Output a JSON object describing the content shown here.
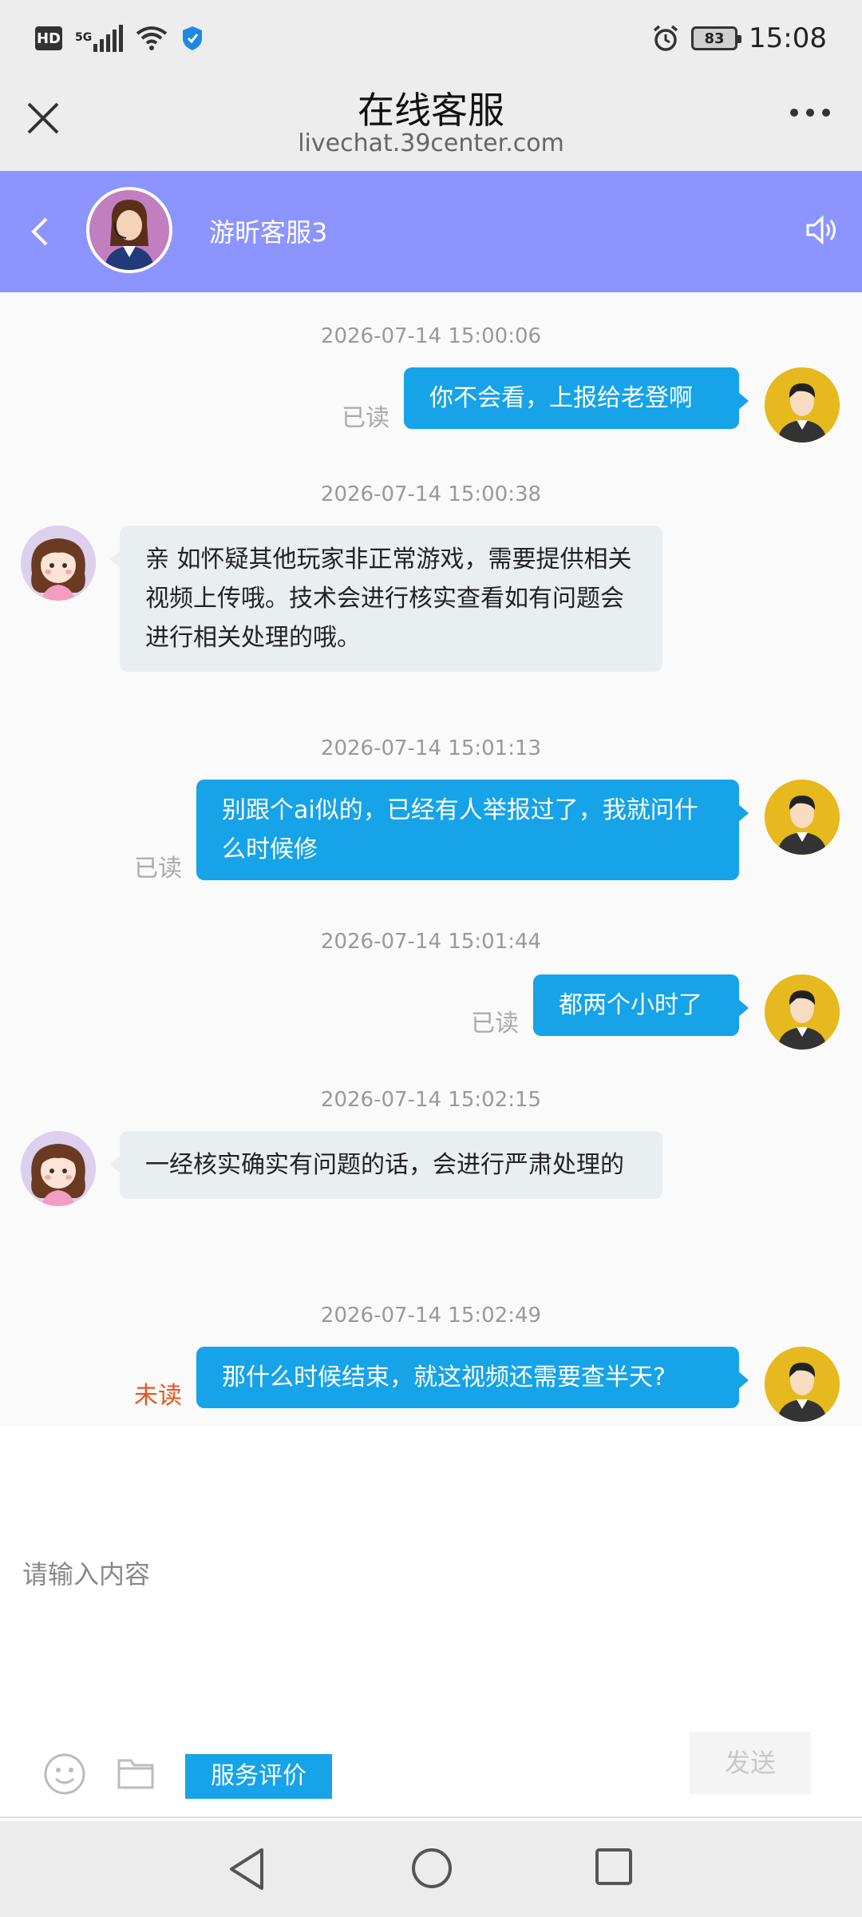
{
  "status_bar": {
    "network_badge": "HD",
    "network_type": "5G",
    "battery": "83",
    "time": "15:08",
    "icons": [
      "signal-icon",
      "wifi-icon",
      "shield-icon",
      "alarm-icon",
      "battery-icon"
    ]
  },
  "title_bar": {
    "title": "在线客服",
    "url": "livechat.39center.com"
  },
  "agent": {
    "name": "游昕客服3",
    "header_color": "#8c94ff"
  },
  "messages": [
    {
      "timestamp": "2026-07-14 15:00:06",
      "from": "user",
      "text": "你不会看，上报给老登啊",
      "status": "已读"
    },
    {
      "timestamp": "2026-07-14 15:00:38",
      "from": "agent",
      "text": "亲 如怀疑其他玩家非正常游戏，需要提供相关视频上传哦。技术会进行核实查看如有问题会进行相关处理的哦。"
    },
    {
      "timestamp": "2026-07-14 15:01:13",
      "from": "user",
      "text": "别跟个ai似的，已经有人举报过了，我就问什么时候修",
      "status": "已读"
    },
    {
      "timestamp": "2026-07-14 15:01:44",
      "from": "user",
      "text": "都两个小时了",
      "status": "已读"
    },
    {
      "timestamp": "2026-07-14 15:02:15",
      "from": "agent",
      "text": "一经核实确实有问题的话，会进行严肃处理的"
    },
    {
      "timestamp": "2026-07-14 15:02:49",
      "from": "user",
      "text": "那什么时候结束，就这视频还需要查半天?",
      "status": "未读"
    }
  ],
  "input": {
    "placeholder": "请输入内容",
    "rate_label": "服务评价",
    "send_label": "发送"
  },
  "colors": {
    "accent": "#16a3e8",
    "unread": "#e8541e"
  }
}
